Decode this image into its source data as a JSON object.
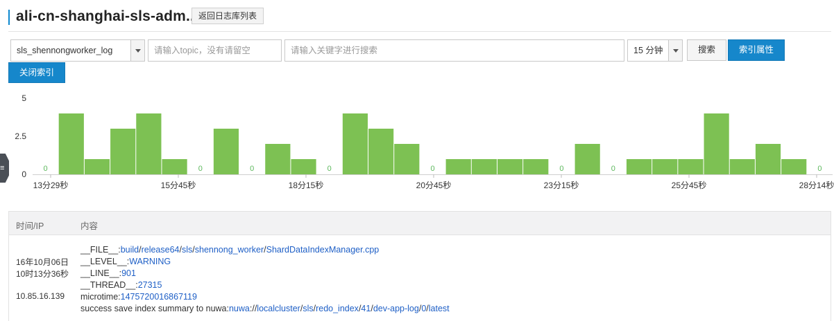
{
  "header": {
    "title": "ali-cn-shanghai-sls-adm...",
    "back_button": "返回日志库列表"
  },
  "toolbar": {
    "logstore_select": "sls_shennongworker_log",
    "topic_placeholder": "请输入topic，没有请留空",
    "keyword_placeholder": "请输入关键字进行搜索",
    "time_range_select": "15 分钟",
    "search_button": "搜索",
    "index_attributes_button": "索引属性",
    "close_index_button": "关闭索引"
  },
  "side_tab_icon": "menu-icon",
  "colors": {
    "bar": "#7dc153",
    "zero_label": "#5cb85c",
    "primary": "#1687cb",
    "link": "#1e5fc6"
  },
  "chart_data": {
    "type": "bar",
    "y_ticks": [
      "5",
      "2.5",
      "0"
    ],
    "ylim": [
      0,
      5
    ],
    "x_tick_labels": [
      "13分29秒",
      "15分45秒",
      "18分15秒",
      "20分45秒",
      "23分15秒",
      "25分45秒",
      "28分14秒"
    ],
    "values": [
      0,
      4,
      1,
      3,
      4,
      1,
      0,
      3,
      0,
      2,
      1,
      0,
      4,
      3,
      2,
      0,
      1,
      1,
      1,
      1,
      0,
      2,
      0,
      1,
      1,
      1,
      4,
      1,
      2,
      1,
      0
    ],
    "zero_label": "0",
    "grid": false
  },
  "log_table": {
    "headers": {
      "time_ip": "时间/IP",
      "content": "内容"
    },
    "rows": [
      {
        "date": "16年10月06日",
        "time": "10时13分36秒",
        "ip": "10.85.16.139",
        "fields": [
          {
            "key": "__FILE__:",
            "segments": [
              "build",
              "/",
              "release64",
              "/",
              "sls",
              "/",
              "shennong_worker",
              "/",
              "ShardDataIndexManager.cpp"
            ]
          },
          {
            "key": "__LEVEL__:",
            "segments": [
              "WARNING"
            ]
          },
          {
            "key": "__LINE__:",
            "segments": [
              "901"
            ]
          },
          {
            "key": "__THREAD__:",
            "segments": [
              "27315"
            ]
          },
          {
            "key": "microtime:",
            "segments": [
              "1475720016867119"
            ]
          },
          {
            "key": "success save index summary to nuwa:",
            "segments": [
              "nuwa",
              "://",
              "localcluster",
              "/",
              "sls",
              "/",
              "redo_index",
              "/",
              "41",
              "/",
              "dev-app-log",
              "/",
              "0",
              "/",
              "latest"
            ]
          }
        ]
      }
    ]
  }
}
